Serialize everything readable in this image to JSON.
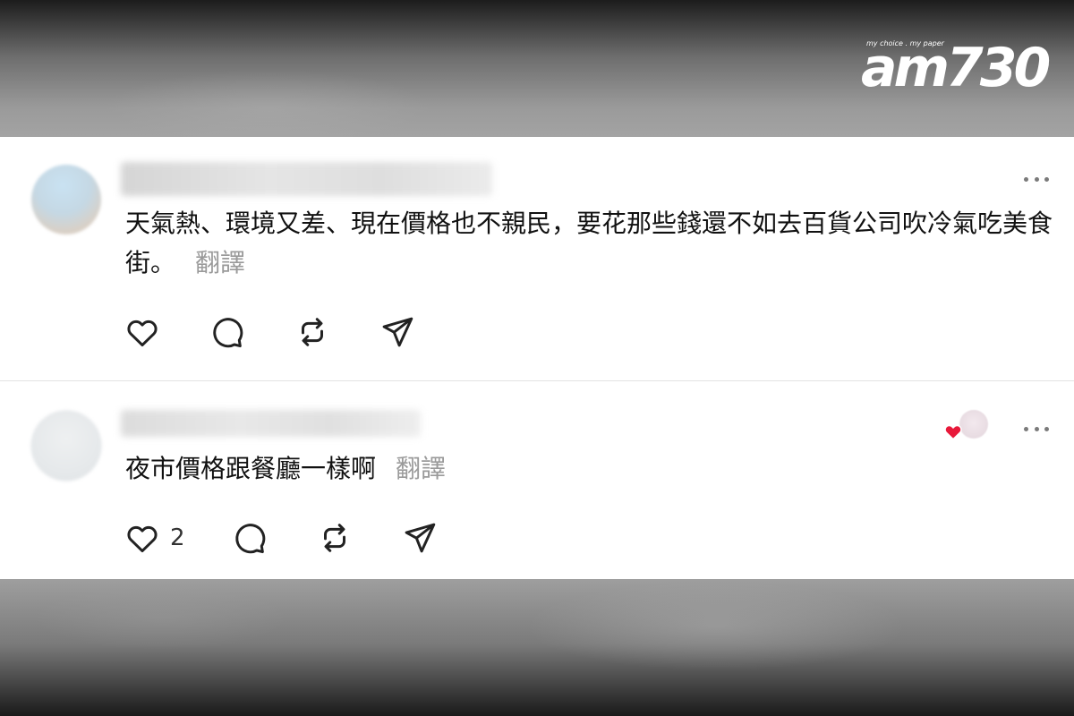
{
  "logo": {
    "tagline": "my choice . my paper",
    "brand": "am730"
  },
  "posts": [
    {
      "text": "天氣熱、環境又差、現在價格也不親民，要花那些錢還不如去百貨公司吹冷氣吃美食街。",
      "translate_label": "翻譯",
      "like_count": ""
    },
    {
      "text": "夜市價格跟餐廳一樣啊",
      "translate_label": "翻譯",
      "like_count": "2"
    }
  ],
  "icons": {
    "more": "more-horizontal-icon",
    "like": "heart-icon",
    "reply": "speech-bubble-icon",
    "repost": "repost-icon",
    "share": "send-icon",
    "liked_badge": "red-heart-icon"
  },
  "colors": {
    "text": "#111111",
    "muted": "#9a9a9a",
    "icon": "#222222",
    "heart_badge": "#e8193a"
  }
}
